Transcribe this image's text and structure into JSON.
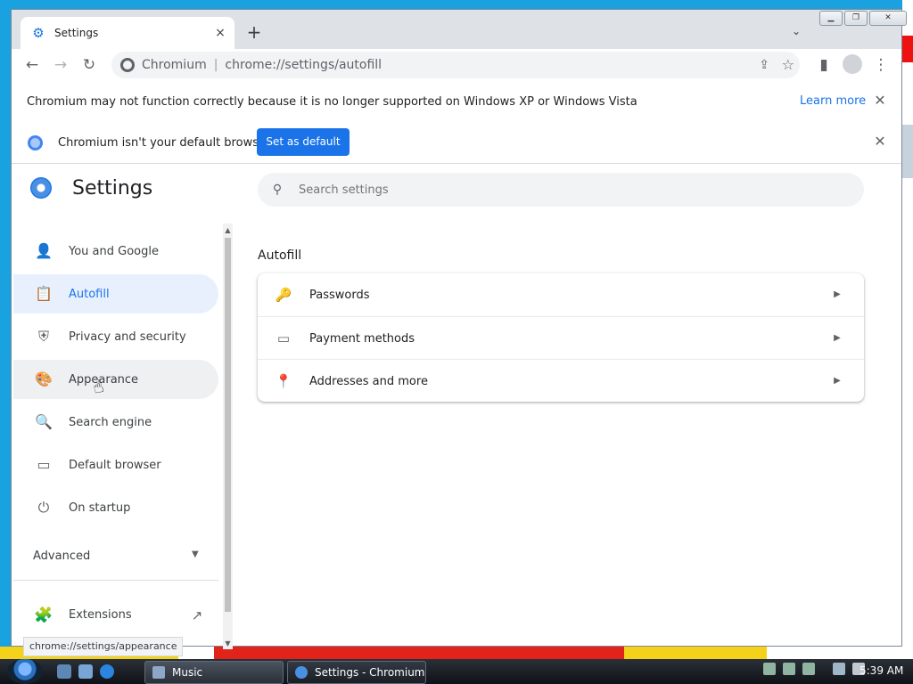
{
  "tab": {
    "title": "Settings",
    "close": "×"
  },
  "toolbar": {
    "new_tab": "+",
    "back": "←",
    "forward": "→",
    "reload": "↻",
    "site": "Chromium",
    "separator": "|",
    "url": "chrome://settings/autofill",
    "share": "⇪",
    "star": "☆",
    "sidepanel": "▮",
    "menu": "⋮",
    "tab_search": "⌄"
  },
  "window_controls": {
    "minimize": "▁",
    "restore": "❐",
    "close": "✕"
  },
  "info_bars": {
    "unsupported": {
      "text": "Chromium may not function correctly because it is no longer supported on Windows XP or Windows Vista",
      "learn_more": "Learn more",
      "close": "✕"
    },
    "default_browser": {
      "text": "Chromium isn't your default browser",
      "button": "Set as default",
      "close": "✕"
    }
  },
  "settings": {
    "title": "Settings",
    "search_placeholder": "Search settings",
    "nav": [
      {
        "label": "You and Google",
        "icon": "person-icon",
        "glyph": "👤"
      },
      {
        "label": "Autofill",
        "icon": "clipboard-icon",
        "glyph": "📋"
      },
      {
        "label": "Privacy and security",
        "icon": "shield-icon",
        "glyph": "⛨"
      },
      {
        "label": "Appearance",
        "icon": "palette-icon",
        "glyph": "🎨"
      },
      {
        "label": "Search engine",
        "icon": "search-icon",
        "glyph": "🔍"
      },
      {
        "label": "Default browser",
        "icon": "browser-icon",
        "glyph": "▭"
      },
      {
        "label": "On startup",
        "icon": "power-icon",
        "glyph": "⏻"
      }
    ],
    "advanced": "Advanced",
    "extensions": "Extensions",
    "section_title": "Autofill",
    "rows": [
      {
        "label": "Passwords",
        "icon": "key-icon",
        "glyph": "🔑"
      },
      {
        "label": "Payment methods",
        "icon": "credit-card-icon",
        "glyph": "▭"
      },
      {
        "label": "Addresses and more",
        "icon": "location-pin-icon",
        "glyph": "📍"
      }
    ]
  },
  "status_tooltip": "chrome://settings/appearance",
  "taskbar": {
    "tasks": [
      {
        "label": "Music"
      },
      {
        "label": "Settings - Chromium"
      }
    ],
    "clock": "5:39 AM"
  },
  "colors": {
    "accent": "#1a73e8",
    "active_nav_bg": "#e8f0fe"
  }
}
